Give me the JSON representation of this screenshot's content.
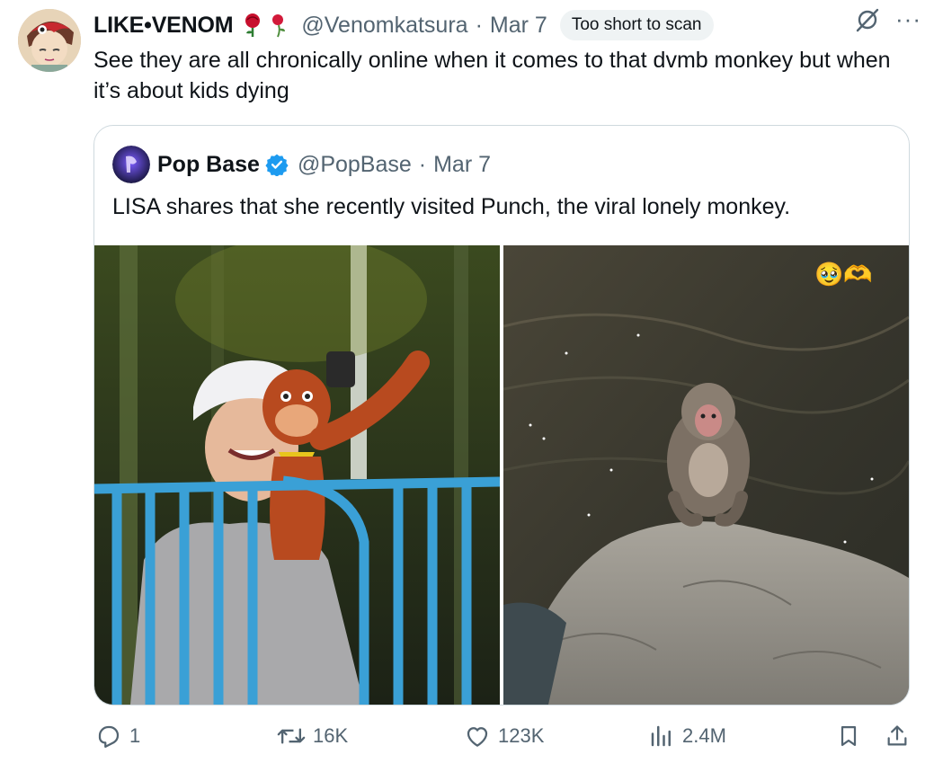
{
  "tweet": {
    "display_name": "LIKE•VENOM",
    "handle": "@Venomkatsura",
    "separator": "·",
    "date": "Mar 7",
    "badge": "Too short to scan",
    "more": "···",
    "text": "See they are all chronically online when it comes to that dvmb monkey but when it’s about kids dying"
  },
  "quote": {
    "name": "Pop Base",
    "handle": "@PopBase",
    "separator": "·",
    "date": "Mar 7",
    "text": "LISA shares that she recently visited Punch, the viral lonely monkey.",
    "images": [
      {
        "alt_icon": "photo-lisa-with-plush-orangutan"
      },
      {
        "alt_icon": "photo-monkey-on-rock",
        "overlay_emoji": "🥹🫶"
      }
    ]
  },
  "actions": {
    "reply": "1",
    "retweet": "16K",
    "like": "123K",
    "views": "2.4M"
  },
  "colors": {
    "text": "#0f1419",
    "muted": "#536471",
    "border": "#cfd9de",
    "verified": "#1d9bf0"
  }
}
